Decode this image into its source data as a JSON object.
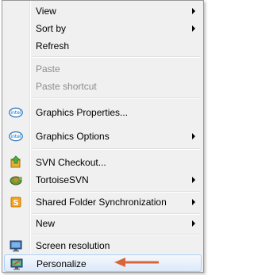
{
  "menu": {
    "items": [
      {
        "label": "View"
      },
      {
        "label": "Sort by"
      },
      {
        "label": "Refresh"
      },
      {
        "label": "Paste"
      },
      {
        "label": "Paste shortcut"
      },
      {
        "label": "Graphics Properties..."
      },
      {
        "label": "Graphics Options"
      },
      {
        "label": "SVN Checkout..."
      },
      {
        "label": "TortoiseSVN"
      },
      {
        "label": "Shared Folder Synchronization"
      },
      {
        "label": "New"
      },
      {
        "label": "Screen resolution"
      },
      {
        "label": "Personalize"
      }
    ],
    "intel_badge_text": "intel",
    "highlight_color": "#dce9f8",
    "disabled_text_color": "#8d8d8d"
  },
  "annotation": {
    "arrow_color": "#d9663a"
  }
}
